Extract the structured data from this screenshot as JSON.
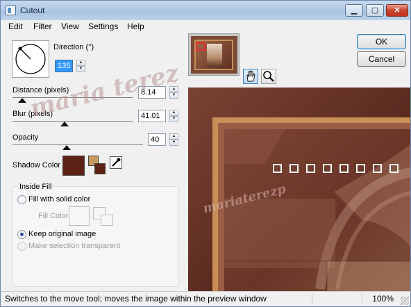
{
  "window": {
    "title": "Cutout",
    "minimize": "▁",
    "maximize": "▢",
    "close": "✕"
  },
  "menu": [
    "Edit",
    "Filter",
    "View",
    "Settings",
    "Help"
  ],
  "direction": {
    "label": "Direction (°)",
    "value": "135"
  },
  "distance": {
    "label": "Distance (pixels)",
    "value": "8.14"
  },
  "blur": {
    "label": "Blur (pixels)",
    "value": "41.01"
  },
  "opacity": {
    "label": "Opacity",
    "value": "40"
  },
  "shadow": {
    "label": "Shadow Color",
    "color": "#5c2215"
  },
  "inside_fill": {
    "title": "Inside Fill",
    "fill_solid": "Fill with solid color",
    "fill_color": "Fill Color",
    "keep_original": "Keep original image",
    "make_transparent": "Make selection transparent"
  },
  "buttons": {
    "ok": "OK",
    "cancel": "Cancel"
  },
  "squares": [
    "",
    "",
    "",
    "",
    "",
    "",
    "",
    ""
  ],
  "watermark": {
    "text1": "maria terez",
    "text2": "mariaterezp"
  },
  "status": {
    "text": "Switches to the move tool; moves the image within the preview window",
    "zoom": "100%"
  }
}
